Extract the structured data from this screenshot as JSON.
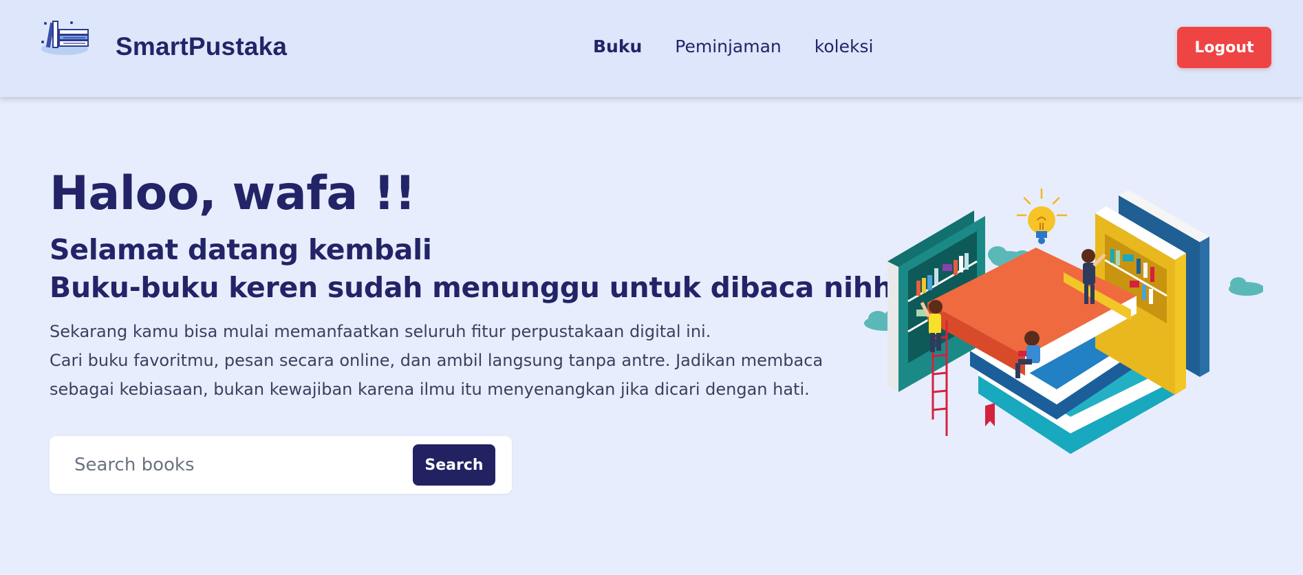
{
  "navbar": {
    "brand": "SmartPustaka",
    "logo_icon": "books-stack-icon",
    "links": [
      {
        "label": "Buku",
        "active": true
      },
      {
        "label": "Peminjaman",
        "active": false
      },
      {
        "label": "koleksi",
        "active": false
      }
    ],
    "logout_label": "Logout"
  },
  "hero": {
    "greeting": "Haloo, wafa !!",
    "welcome_line1": "Selamat datang kembali",
    "welcome_line2": "Buku-buku keren sudah menunggu untuk dibaca nihh",
    "desc_line1": "Sekarang kamu bisa mulai memanfaatkan seluruh fitur perpustakaan digital ini.",
    "desc_line2": "Cari buku favoritmu, pesan secara online, dan ambil langsung tanpa antre. Jadikan membaca sebagai kebiasaan, bukan kewajiban karena ilmu itu menyenangkan jika dicari dengan hati."
  },
  "search": {
    "placeholder": "Search books",
    "value": "",
    "button_label": "Search"
  },
  "illustration": {
    "name": "library-books-illustration"
  },
  "colors": {
    "background": "#e7edfc",
    "navbar": "#dde6fa",
    "primary": "#232467",
    "logout": "#ef4444",
    "search_button": "#222263"
  }
}
